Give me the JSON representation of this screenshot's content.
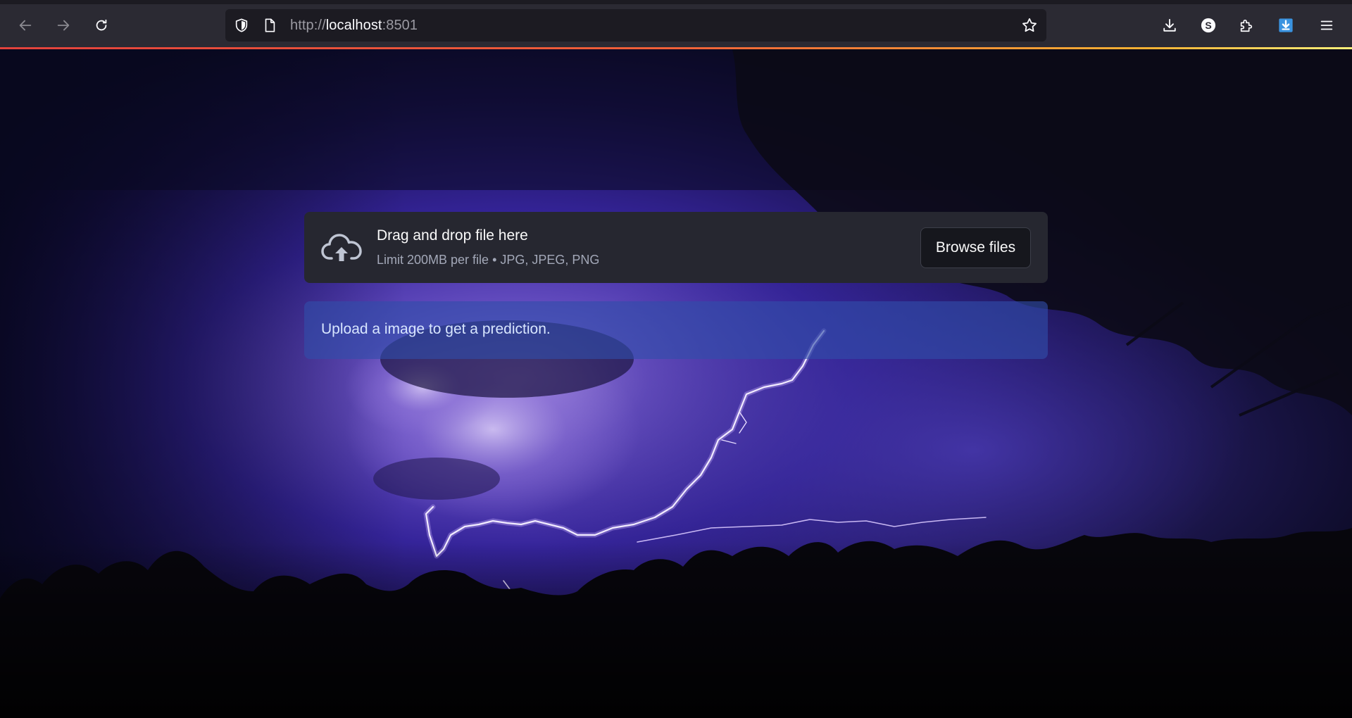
{
  "browser": {
    "url_scheme": "http://",
    "url_host": "localhost",
    "url_port": ":8501",
    "profile_initial": "S",
    "accent_progress": [
      "#e2423c",
      "#f9b233"
    ]
  },
  "uploader": {
    "title": "Drag and drop file here",
    "subtitle": "Limit 200MB per file • JPG, JPEG, PNG",
    "browse_label": "Browse files"
  },
  "info": {
    "message": "Upload a image to get a prediction."
  },
  "colors": {
    "uploader_bg": "#262730",
    "info_bg": "#304eaa",
    "info_text": "#d8e6ff"
  }
}
